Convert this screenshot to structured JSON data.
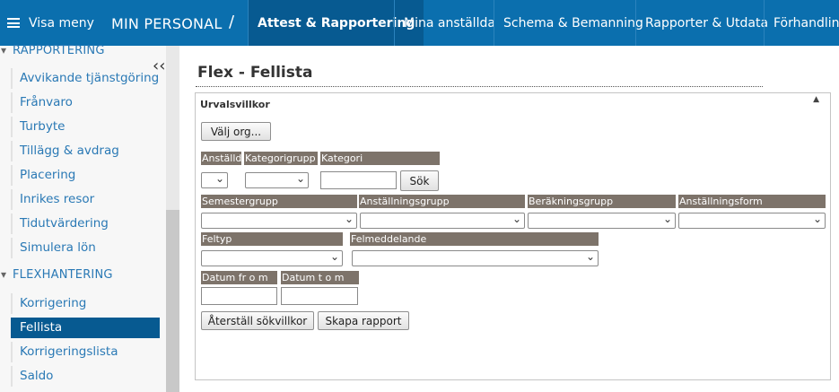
{
  "topbar": {
    "menu_label": "Visa meny",
    "app_title": "MIN PERSONAL",
    "separator": "/",
    "tabs": [
      {
        "label": "Attest & Rapportering",
        "active": true
      },
      {
        "label": "Mina anställda"
      },
      {
        "label": "Schema & Bemanning"
      },
      {
        "label": "Rapporter & Utdata"
      },
      {
        "label": "Förhandling"
      }
    ],
    "colors": {
      "bar": "#0b6fae",
      "active_tab": "#075a91"
    }
  },
  "sidebar": {
    "sections": [
      {
        "header": "RAPPORTERING",
        "items": [
          "Avvikande tjänstgöring",
          "Frånvaro",
          "Turbyte",
          "Tillägg & avdrag",
          "Placering",
          "Inrikes resor",
          "Tidutvärdering",
          "Simulera lön"
        ]
      },
      {
        "header": "FLEXHANTERING",
        "items": [
          "Korrigering",
          "Fellista",
          "Korrigeringslista",
          "Saldo"
        ]
      }
    ],
    "active_item": "Fellista",
    "collapse_icon": "double-chevron-left-icon"
  },
  "main": {
    "title": "Flex - Fellista",
    "panel": {
      "title": "Urvalsvillkor",
      "choose_org_button": "Välj org...",
      "fields": {
        "anstalld": "Anställd",
        "kategorigrupp": "Kategorigrupp",
        "kategori": "Kategori",
        "search_button": "Sök",
        "semestergrupp": "Semestergrupp",
        "anstallningsgrupp": "Anställningsgrupp",
        "berakningsgrupp": "Beräkningsgrupp",
        "anstallningsform": "Anställningsform",
        "feltyp": "Feltyp",
        "felmeddelande": "Felmeddelande",
        "datum_from": "Datum fr o m",
        "datum_tom": "Datum t o m"
      },
      "reset_button": "Återställ sökvillkor",
      "create_report_button": "Skapa rapport"
    }
  }
}
